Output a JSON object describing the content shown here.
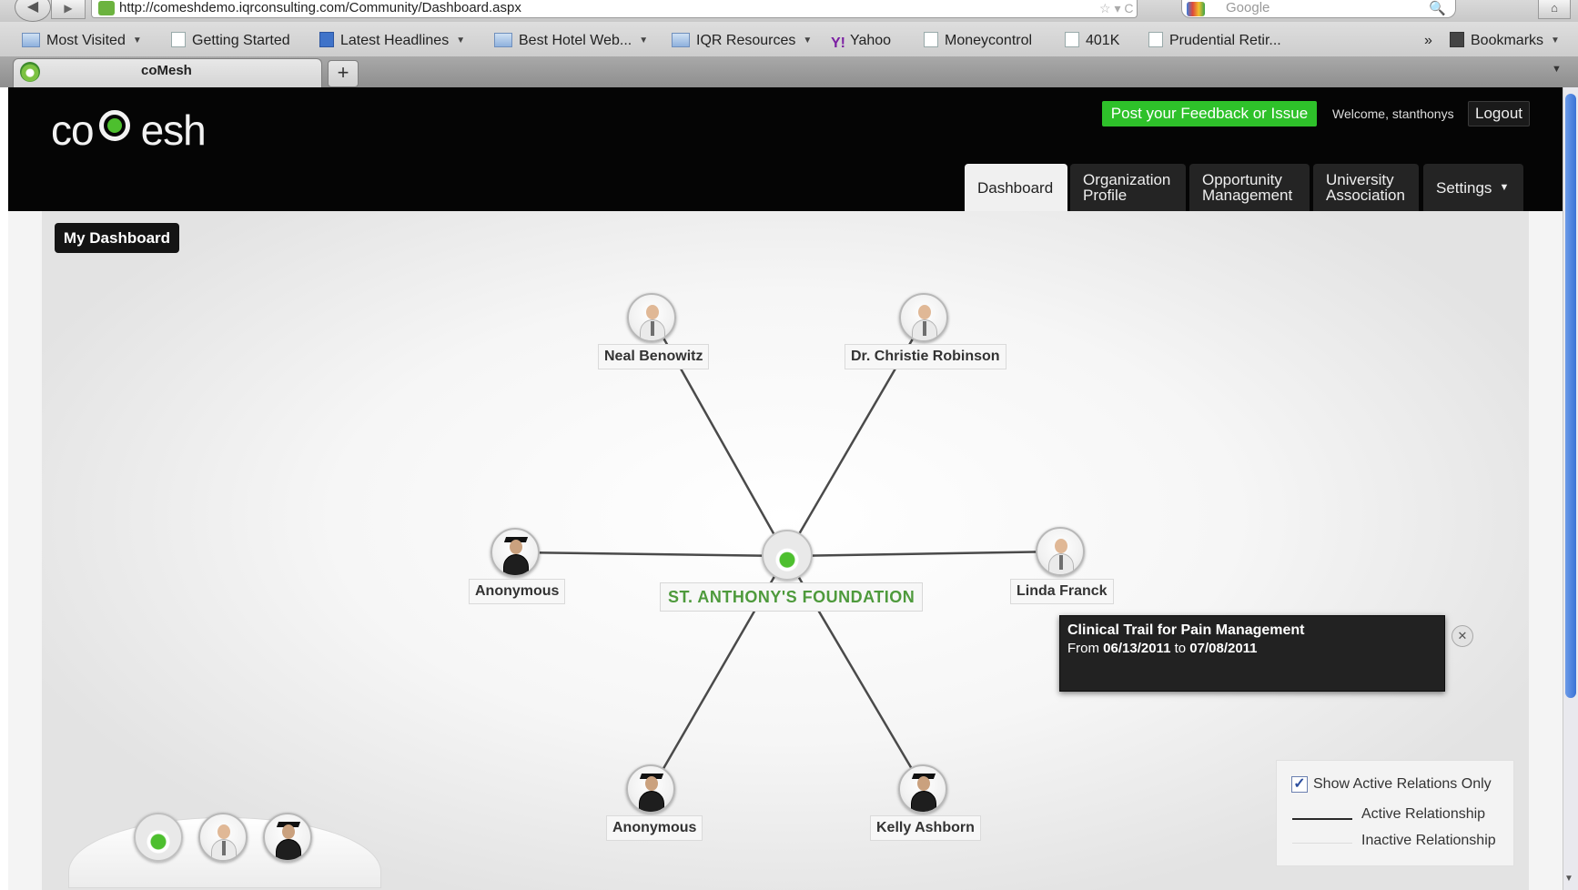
{
  "browser": {
    "url": "http://comeshdemo.iqrconsulting.com/Community/Dashboard.aspx",
    "search_placeholder": "Google",
    "tab_title": "coMesh",
    "new_tab": "+",
    "bookmarks": [
      {
        "label": "Most Visited",
        "icon": "most-visited-icon",
        "menu": true
      },
      {
        "label": "Getting Started",
        "icon": "page-icon",
        "menu": false
      },
      {
        "label": "Latest Headlines",
        "icon": "rss-feed-icon",
        "menu": true
      },
      {
        "label": "Best Hotel Web...",
        "icon": "folder-icon",
        "menu": true
      },
      {
        "label": "IQR Resources",
        "icon": "folder-icon",
        "menu": true
      },
      {
        "label": "Yahoo",
        "icon": "yahoo-icon",
        "menu": false
      },
      {
        "label": "Moneycontrol",
        "icon": "page-icon",
        "menu": false
      },
      {
        "label": "401K",
        "icon": "page-icon",
        "menu": false
      },
      {
        "label": "Prudential Retir...",
        "icon": "page-icon",
        "menu": false
      }
    ],
    "bookmarks_overflow": "»",
    "bookmarks_menu": "Bookmarks"
  },
  "header": {
    "logo": "coMesh",
    "feedback_button": "Post your Feedback or Issue",
    "welcome": "Welcome, stanthonys",
    "logout": "Logout",
    "nav": [
      {
        "label": "Dashboard",
        "active": true
      },
      {
        "label": "Organization Profile",
        "active": false
      },
      {
        "label": "Opportunity Management",
        "active": false
      },
      {
        "label": "University Association",
        "active": false
      },
      {
        "label": "Settings",
        "active": false,
        "menu": true
      }
    ]
  },
  "dashboard": {
    "title": "My Dashboard",
    "center": {
      "label": "ST. ANTHONY'S FOUNDATION",
      "icon": "organization-icon"
    },
    "nodes": [
      {
        "label": "Neal Benowitz",
        "icon": "doctor-icon"
      },
      {
        "label": "Dr. Christie Robinson",
        "icon": "doctor-icon"
      },
      {
        "label": "Anonymous",
        "icon": "student-icon"
      },
      {
        "label": "Linda Franck",
        "icon": "doctor-icon"
      },
      {
        "label": "Anonymous",
        "icon": "student-icon"
      },
      {
        "label": "Kelly Ashborn",
        "icon": "student-icon"
      }
    ],
    "tooltip": {
      "title": "Clinical Trail for Pain Management",
      "from_label": "From",
      "from_date": "06/13/2011",
      "to_label": "to",
      "to_date": "07/08/2011"
    },
    "legend": {
      "show_active_only": "Show Active Relations Only",
      "show_active_checked": true,
      "active": "Active Relationship",
      "inactive": "Inactive Relationship"
    },
    "filter_icons": [
      "organization-icon",
      "doctor-icon",
      "student-icon"
    ]
  },
  "colors": {
    "header_bg": "#050505",
    "feedback_green": "#2ec12a",
    "brand_green": "#4dbf2e",
    "center_label_green": "#4e9a3c"
  }
}
